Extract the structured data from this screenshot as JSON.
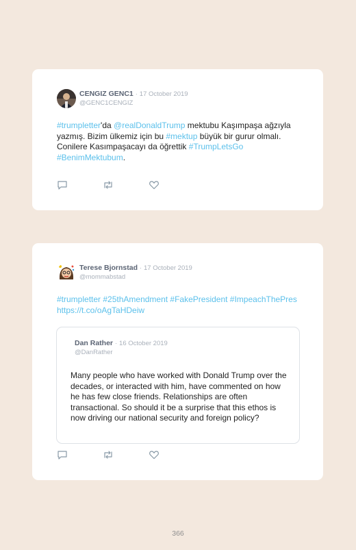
{
  "tweets": [
    {
      "author": "CENGIZ GENC1",
      "separator": "·",
      "date": "17 October 2019",
      "handle": "@GENC1CENGIZ",
      "text_parts": [
        {
          "t": "#trumpletter",
          "link": true
        },
        {
          "t": "'da ",
          "link": false
        },
        {
          "t": "@realDonaldTrump",
          "link": true
        },
        {
          "t": " mektubu Kaşımpaşa ağzıyla yazmış. Bizim ülkemiz için bu ",
          "link": false
        },
        {
          "t": "#mektup",
          "link": true
        },
        {
          "t": " büyük bir gurur olmalı. Conilere Kasımpaşacayı da öğrettik ",
          "link": false
        },
        {
          "t": "#TrumpLetsGo #BenimMektubum",
          "link": true
        },
        {
          "t": ".",
          "link": false
        }
      ]
    },
    {
      "author": "Terese Bjornstad",
      "separator": "·",
      "date": "17 October 2019",
      "handle": "@mommabstad",
      "text_parts": [
        {
          "t": "#trumpletter #25thAmendment #FakePresident #ImpeachThePres https://t.co/oAgTaHDeiw",
          "link": true
        }
      ],
      "quote": {
        "author": "Dan Rather",
        "separator": "·",
        "date": "16 October 2019",
        "handle": "@DanRather",
        "text": "Many people who have worked with Donald Trump over the decades, or interacted with him, have commented on how he has few close friends. Relationships are often transactional. So should it be a surprise that this ethos is now driving our national security and foreign policy?"
      }
    }
  ],
  "icons": [
    "reply-icon",
    "retweet-icon",
    "like-icon"
  ],
  "colors": {
    "background": "#f3e8de",
    "link": "#5bc0eb",
    "icon": "#8899a6"
  },
  "page_number": "366"
}
